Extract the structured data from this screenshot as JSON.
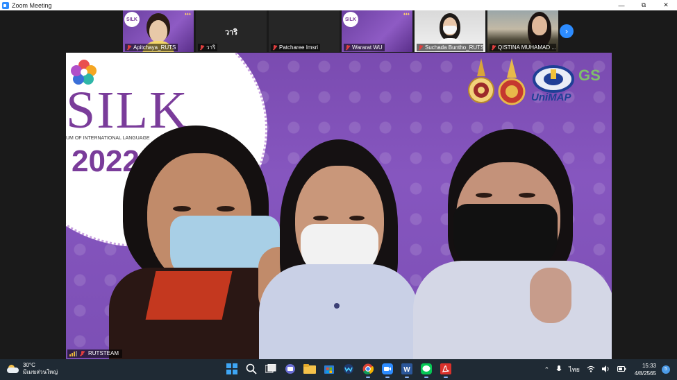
{
  "window": {
    "title": "Zoom Meeting",
    "controls": {
      "minimize": "—",
      "restore": "⧉",
      "close": "✕"
    }
  },
  "thumbnails": [
    {
      "name": "Apitchaya_RUTS",
      "video": "silk-background",
      "muted": true
    },
    {
      "name": "วาริ",
      "display_text": "วาริ",
      "video": "off",
      "muted": true
    },
    {
      "name": "Patcharee Imsri",
      "video": "off",
      "muted": true
    },
    {
      "name": "Wararat WU",
      "video": "silk-background",
      "muted": true
    },
    {
      "name": "Suchada Buntho_RUTS",
      "video": "camera",
      "muted": true
    },
    {
      "name": "QISTINA MUHAMAD ...",
      "video": "camera",
      "muted": true
    }
  ],
  "next_page_icon": "chevron-right-icon",
  "main_video": {
    "participant": "RUTSTEAM",
    "background": {
      "logo_text": "SILK",
      "logo_subtext": "UM OF INTERNATIONAL LANGUAGE",
      "logo_year": "2022",
      "partner_logo_text": "UniMAP",
      "partner_logo_text_2": "GS"
    }
  },
  "taskbar": {
    "weather_temp": "30°C",
    "weather_desc": "มีเมฆส่วนใหญ่",
    "apps": [
      {
        "icon": "windows-start-icon",
        "active": false
      },
      {
        "icon": "search-icon",
        "active": false
      },
      {
        "icon": "task-view-icon",
        "active": false
      },
      {
        "icon": "teams-chat-icon",
        "active": false
      },
      {
        "icon": "file-explorer-icon",
        "active": false
      },
      {
        "icon": "microsoft-store-icon",
        "active": false
      },
      {
        "icon": "word-alt-icon",
        "active": false
      },
      {
        "icon": "chrome-icon",
        "active": true
      },
      {
        "icon": "zoom-icon",
        "active": true
      },
      {
        "icon": "word-icon",
        "active": true
      },
      {
        "icon": "line-icon",
        "active": true
      },
      {
        "icon": "acrobat-icon",
        "active": true
      }
    ],
    "tray": {
      "language": "ไทย",
      "time": "15:33",
      "date": "4/8/2565",
      "notification_count": "5"
    }
  },
  "colors": {
    "zoom_blue": "#2d8cff",
    "muted_red": "#e03e3e",
    "background_purple": "#7a4bb0",
    "silk_purple": "#7a3c9a"
  }
}
